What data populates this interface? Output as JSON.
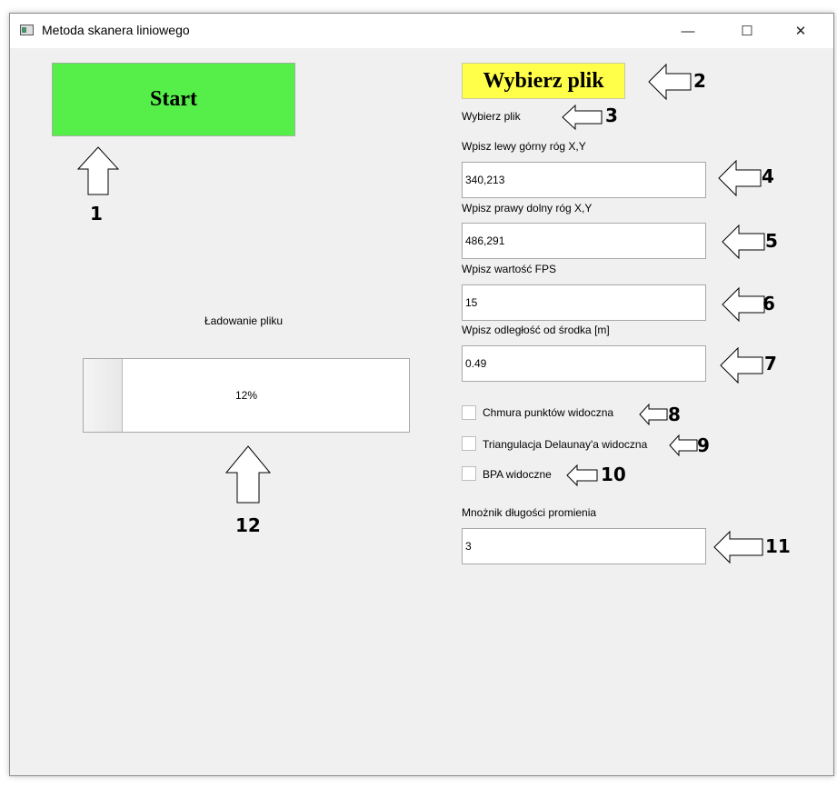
{
  "window": {
    "title": "Metoda skanera liniowego",
    "minimize": "—",
    "maximize": "☐",
    "close": "✕"
  },
  "buttons": {
    "start": "Start",
    "choose_file": "Wybierz plik"
  },
  "labels": {
    "file_status": "Wybierz plik",
    "top_left": "Wpisz lewy górny róg X,Y",
    "bottom_right": "Wpisz prawy dolny róg X,Y",
    "fps": "Wpisz wartość FPS",
    "distance": "Wpisz odległość od środka [m]",
    "radius": "Mnożnik długości promienia",
    "loading": "Ładowanie pliku"
  },
  "fields": {
    "top_left": "340,213",
    "bottom_right": "486,291",
    "fps": "15",
    "distance": "0.49",
    "radius": "3"
  },
  "checkboxes": [
    {
      "label": "Chmura punktów widoczna",
      "checked": false
    },
    {
      "label": "Triangulacja Delaunay'a widoczna",
      "checked": false
    },
    {
      "label": "BPA widoczne",
      "checked": false
    }
  ],
  "progress": {
    "value": 0.12,
    "text": "12%"
  },
  "annotations": [
    "1",
    "2",
    "3",
    "4",
    "5",
    "6",
    "7",
    "8",
    "9",
    "10",
    "11",
    "12"
  ]
}
